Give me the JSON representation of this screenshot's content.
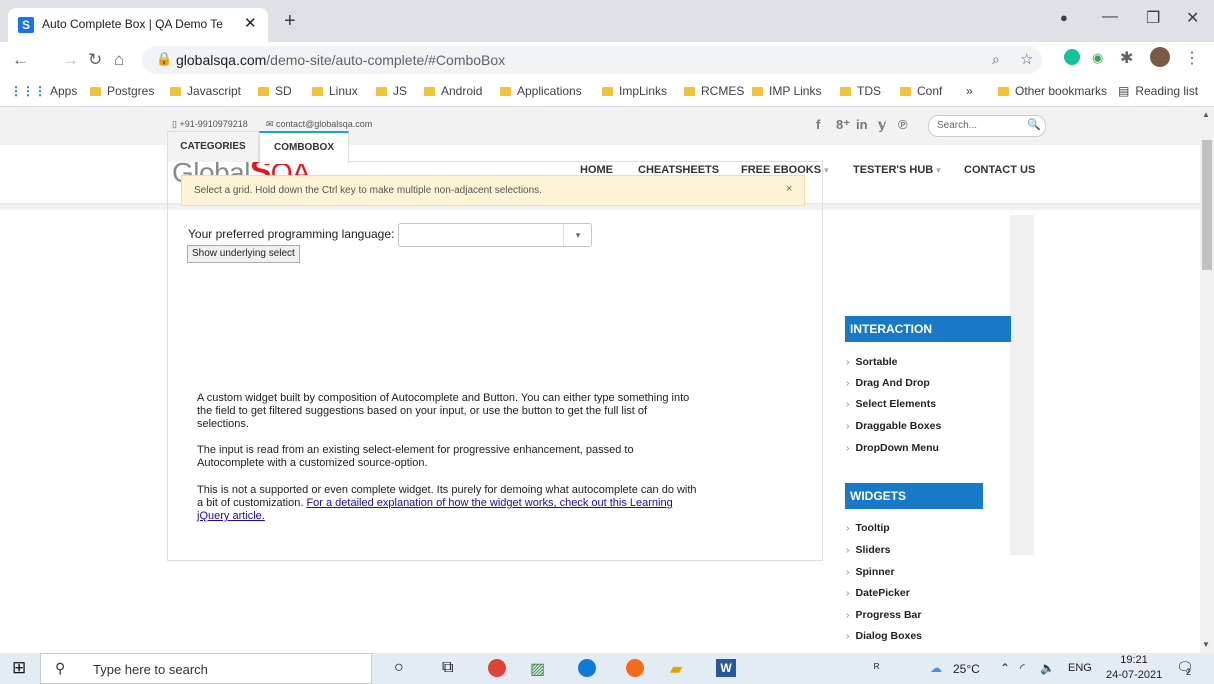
{
  "browser": {
    "tab_title": "Auto Complete Box | QA Demo Te",
    "tab_favicon": "S",
    "new_tab": "+",
    "url_host": "globalsqa.com",
    "url_path": "/demo-site/auto-complete/#ComboBox",
    "bookmarks": [
      "Apps",
      "Postgres",
      "Javascript",
      "SD",
      "Linux",
      "JS",
      "Android",
      "Applications",
      "ImpLinks",
      "RCMES",
      "IMP Links",
      "TDS",
      "Conf"
    ],
    "more_bookmarks": "»",
    "other_bookmarks": "Other bookmarks",
    "reading_list": "Reading list"
  },
  "site": {
    "phone": "+91-9910979218",
    "email": "contact@globalsqa.com",
    "search_placeholder": "Search...",
    "logo_text": "Global",
    "logo_s": "S",
    "logo_qa": "QA",
    "nav": [
      "HOME",
      "CHEATSHEETS",
      "FREE EBOOKS",
      "TESTER'S HUB",
      "CONTACT US"
    ],
    "social": [
      "f",
      "8⁺",
      "in",
      "𝕪",
      "℗"
    ]
  },
  "demo": {
    "tabs": [
      "CATEGORIES",
      "COMBOBOX"
    ],
    "alert": "Select a grid. Hold down the Ctrl key to make multiple non-adjacent selections.",
    "alert_close": "×",
    "label": "Your preferred programming language:",
    "combo_value": "",
    "show_button": "Show underlying select",
    "para1": "A custom widget built by composition of Autocomplete and Button. You can either type something into the field to get filtered suggestions based on your input, or use the button to get the full list of selections.",
    "para2": "The input is read from an existing select-element for progressive enhancement, passed to Autocomplete with a customized source-option.",
    "para3_text": "This is not a supported or even complete widget. Its purely for demoing what autocomplete can do with a bit of customization. ",
    "para3_link": "For a detailed explanation of how the widget works, check out this Learning jQuery article."
  },
  "sidebar": {
    "interaction_title": "INTERACTION",
    "interaction_items": [
      "Sortable",
      "Drag And Drop",
      "Select Elements",
      "Draggable Boxes",
      "DropDown Menu"
    ],
    "widgets_title": "WIDGETS",
    "widgets_items": [
      "Tooltip",
      "Sliders",
      "Spinner",
      "DatePicker",
      "Progress Bar",
      "Dialog Boxes"
    ]
  },
  "taskbar": {
    "search_placeholder": "Type here to search",
    "temperature": "25°C",
    "language": "ENG",
    "time": "19:21",
    "date": "24-07-2021",
    "notifications": "2"
  },
  "colors": {
    "accent": "#1779c8",
    "logo_red": "#e8141c",
    "tab_active_border": "#1ba1e2"
  }
}
